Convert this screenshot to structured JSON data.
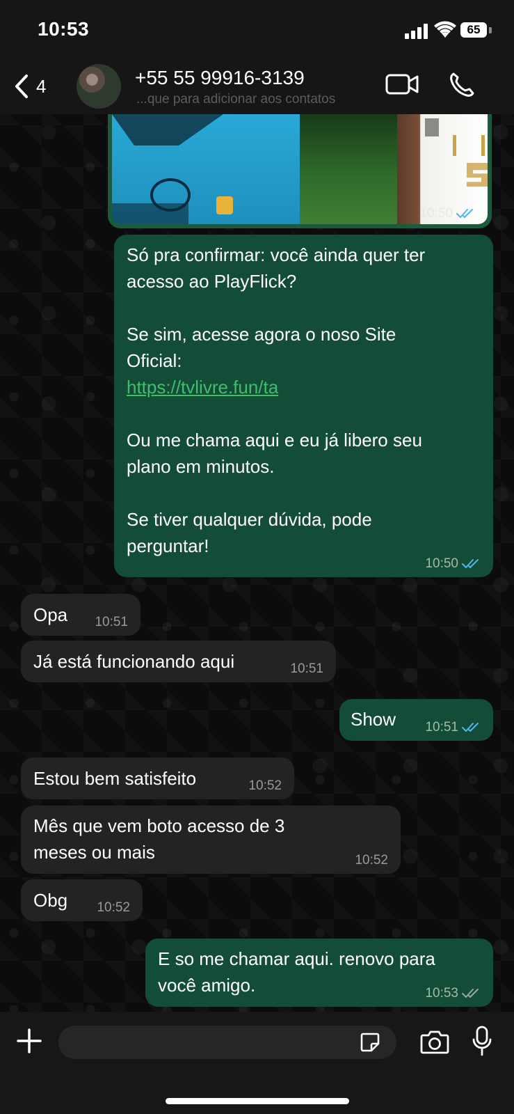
{
  "status_bar": {
    "time": "10:53",
    "battery": "65"
  },
  "header": {
    "back_count": "4",
    "contact_name": "+55 55 99916-3139",
    "subtitle": "...que para adicionar aos contatos"
  },
  "input": {
    "placeholder": ""
  },
  "colors": {
    "outgoing_bubble": "#144d37",
    "incoming_bubble": "#232323",
    "read_tick": "#4fb6ec",
    "link": "#3fbf6a"
  },
  "icons": [
    "back-chevron-icon",
    "video-camera-icon",
    "phone-icon",
    "plus-icon",
    "sticker-icon",
    "camera-icon",
    "microphone-icon"
  ],
  "messages": [
    {
      "id": "img",
      "direction": "out",
      "type": "image",
      "time": "10:50",
      "status": "read"
    },
    {
      "id": "m1",
      "direction": "out",
      "type": "text",
      "text_part1": "Só pra confirmar: você ainda quer ter\nacesso ao PlayFlick?\n\nSe sim, acesse agora o noso Site\nOficial:\n",
      "link": "https://tvlivre.fun/ta",
      "text_part2": "\n\nOu me chama aqui e eu já libero seu\nplano em minutos.\n\nSe tiver qualquer dúvida, pode\nperguntar!",
      "time": "10:50",
      "status": "read"
    },
    {
      "id": "m2",
      "direction": "in",
      "text": "Opa",
      "time": "10:51"
    },
    {
      "id": "m3",
      "direction": "in",
      "text": "Já está funcionando aqui",
      "time": "10:51"
    },
    {
      "id": "m4",
      "direction": "out",
      "text": "Show",
      "time": "10:51",
      "status": "read"
    },
    {
      "id": "m5",
      "direction": "in",
      "text": "Estou bem satisfeito",
      "time": "10:52"
    },
    {
      "id": "m6",
      "direction": "in",
      "text": "Mês que vem boto acesso de 3\nmeses ou mais",
      "time": "10:52"
    },
    {
      "id": "m7",
      "direction": "in",
      "text": "Obg",
      "time": "10:52"
    },
    {
      "id": "m8",
      "direction": "out",
      "text": "E so me chamar aqui. renovo para\nvocê amigo.",
      "time": "10:53",
      "status": "delivered"
    }
  ]
}
